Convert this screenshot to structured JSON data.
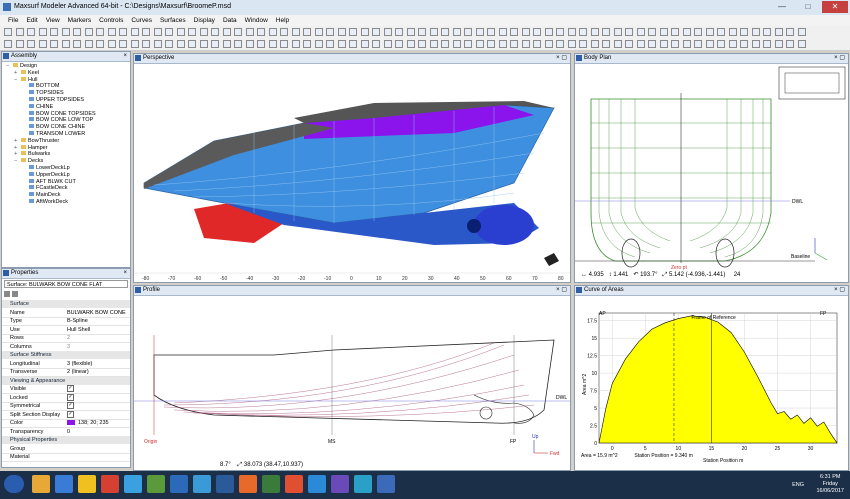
{
  "window": {
    "title": "Maxsurf Modeler Advanced 64-bit - C:\\Designs\\Maxsurf\\BroomeP.msd",
    "minimize": "—",
    "maximize": "□",
    "close": "✕"
  },
  "menu": [
    "File",
    "Edit",
    "View",
    "Markers",
    "Controls",
    "Curves",
    "Surfaces",
    "Display",
    "Data",
    "Window",
    "Help"
  ],
  "assembly": {
    "title": "Assembly",
    "tree": [
      {
        "label": "Design",
        "indent": 0,
        "exp": "−"
      },
      {
        "label": "Keel",
        "indent": 1,
        "exp": "+"
      },
      {
        "label": "Hull",
        "indent": 1,
        "exp": "−"
      },
      {
        "label": "BOTTOM",
        "indent": 2,
        "exp": ""
      },
      {
        "label": "TOPSIDES",
        "indent": 2,
        "exp": ""
      },
      {
        "label": "UPPER TOPSIDES",
        "indent": 2,
        "exp": ""
      },
      {
        "label": "CHINE",
        "indent": 2,
        "exp": ""
      },
      {
        "label": "BOW CONE TOPSIDES",
        "indent": 2,
        "exp": ""
      },
      {
        "label": "BOW CONE LOW TOP",
        "indent": 2,
        "exp": ""
      },
      {
        "label": "BOW CONE CHINE",
        "indent": 2,
        "exp": ""
      },
      {
        "label": "TRANSOM LOWER",
        "indent": 2,
        "exp": ""
      },
      {
        "label": "BowThruster",
        "indent": 1,
        "exp": "+"
      },
      {
        "label": "Hamper",
        "indent": 1,
        "exp": "+"
      },
      {
        "label": "Bulwarks",
        "indent": 1,
        "exp": "+"
      },
      {
        "label": "Decks",
        "indent": 1,
        "exp": "−"
      },
      {
        "label": "LowerDeckLp",
        "indent": 2,
        "exp": ""
      },
      {
        "label": "UpperDeckLp",
        "indent": 2,
        "exp": ""
      },
      {
        "label": "AFT BLWK CUT",
        "indent": 2,
        "exp": ""
      },
      {
        "label": "FCastleDeck",
        "indent": 2,
        "exp": ""
      },
      {
        "label": "MainDeck",
        "indent": 2,
        "exp": ""
      },
      {
        "label": "AftWorkDeck",
        "indent": 2,
        "exp": ""
      }
    ]
  },
  "properties": {
    "title": "Properties",
    "selector": "Surface: BULWARK BOW CONE FLAT",
    "sections": [
      {
        "name": "Surface",
        "rows": [
          [
            "Name",
            "BULWARK BOW CONE"
          ],
          [
            "Type",
            "B-Spline"
          ],
          [
            "Use",
            "Hull Shell"
          ],
          [
            "Rows",
            "2"
          ],
          [
            "Columns",
            "3"
          ]
        ]
      },
      {
        "name": "Surface Stiffness",
        "rows": [
          [
            "Longitudinal",
            "3 (flexible)"
          ],
          [
            "Transverse",
            "2 (linear)"
          ]
        ]
      },
      {
        "name": "Viewing & Appearance",
        "rows": [
          [
            "Visible",
            "✓"
          ],
          [
            "Locked",
            "✓"
          ],
          [
            "Symmetrical",
            "✓"
          ],
          [
            "Split Section Display",
            "✓"
          ],
          [
            "Color",
            "138; 20; 235"
          ],
          [
            "Transparency",
            "0"
          ]
        ]
      },
      {
        "name": "Physical Properties",
        "rows": [
          [
            "Group",
            ""
          ],
          [
            "Material",
            ""
          ]
        ]
      }
    ],
    "color_value": "#8a14eb"
  },
  "perspective": {
    "title": "Perspective",
    "ruler": [
      "-80",
      "-70",
      "-60",
      "-50",
      "-40",
      "-30",
      "-20",
      "-10",
      "0",
      "10",
      "20",
      "30",
      "40",
      "50",
      "60",
      "70",
      "80"
    ]
  },
  "body_plan": {
    "title": "Body Plan",
    "dwl": "DWL",
    "baseline": "Baseline",
    "zero_pt": "Zero pt",
    "status": [
      "4.935",
      "1.441",
      "193.7°",
      "5.142 (-4.936,-1.441)",
      "24"
    ]
  },
  "profile": {
    "title": "Profile",
    "dwl": "DWL",
    "origin": "Origin",
    "ms": "MS",
    "fp": "FP",
    "up": "Up",
    "fwd": "Fwd",
    "status": [
      "8.7°",
      "38.073 (38.47,10.937)"
    ]
  },
  "curve_of_areas": {
    "title": "Curve of Areas",
    "frame_label": "Frame of Reference",
    "ap": "AP",
    "fp": "FP",
    "status": [
      "Area = 15.9 m^2",
      "Station Position = 9.340 m"
    ]
  },
  "chart_data": {
    "type": "area",
    "title": "",
    "xlabel": "Station Position  m",
    "ylabel": "Area  m^2",
    "x": [
      -2,
      -1,
      0,
      2,
      4,
      6,
      8,
      10,
      12,
      14,
      16,
      18,
      20,
      22,
      24,
      25,
      26,
      27,
      28,
      29,
      30,
      31,
      32,
      33,
      34
    ],
    "y": [
      0,
      4.8,
      8.5,
      12.0,
      14.5,
      16.3,
      17.2,
      17.8,
      18.2,
      18.0,
      17.3,
      15.8,
      13.0,
      9.5,
      5.8,
      4.2,
      4.5,
      3.4,
      4.0,
      2.8,
      3.6,
      2.4,
      3.0,
      1.4,
      0
    ],
    "xticks": [
      0,
      5,
      10,
      15,
      20,
      25,
      30
    ],
    "yticks": [
      0,
      2.5,
      5,
      7.5,
      10,
      12.5,
      15,
      17.5
    ],
    "xlim": [
      -2,
      34
    ],
    "ylim": [
      0,
      18.6
    ],
    "grid": true,
    "fill_color": "#ffff00",
    "cursor_x": 9.34,
    "frame_x": 15
  },
  "taskbar": {
    "time": "6:31 PM",
    "day": "Friday",
    "date": "16/06/2017",
    "lang": "ENG"
  }
}
